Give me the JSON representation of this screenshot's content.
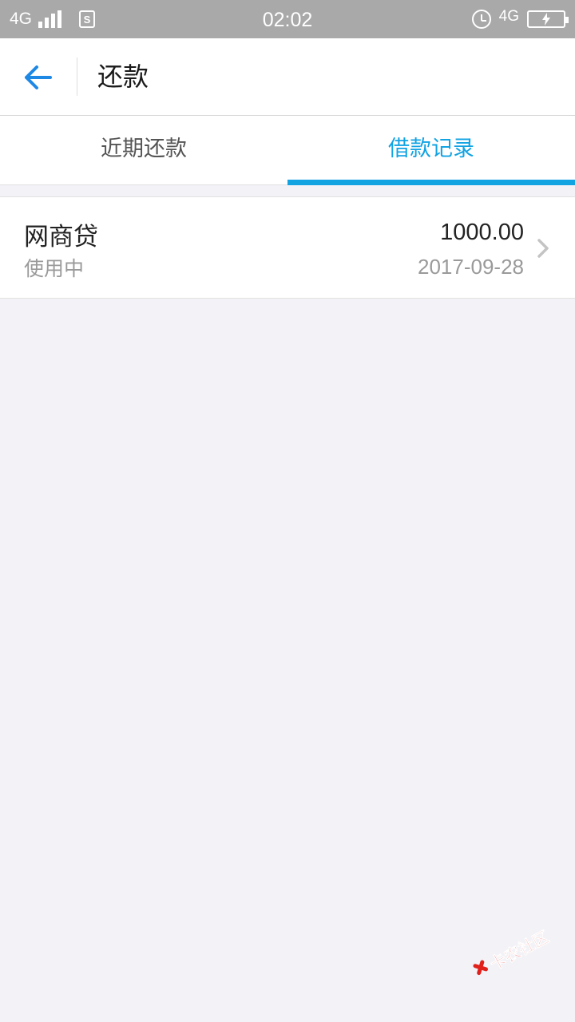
{
  "status_bar": {
    "network_left": "4G",
    "time": "02:02",
    "network_right": "4G"
  },
  "header": {
    "title": "还款"
  },
  "tabs": [
    {
      "label": "近期还款",
      "active": false
    },
    {
      "label": "借款记录",
      "active": true
    }
  ],
  "records": [
    {
      "name": "网商贷",
      "status": "使用中",
      "amount": "1000.00",
      "date": "2017-09-28"
    }
  ],
  "watermark": {
    "text": "卡农社区"
  },
  "colors": {
    "accent": "#12a3e3",
    "back_arrow": "#1e88e5",
    "background": "#f2f2f7",
    "status_bar": "#a9a9a9"
  },
  "icons": {
    "back": "arrow-left-icon",
    "row_chevron": "chevron-right-icon",
    "alarm": "alarm-icon",
    "battery": "battery-charging-icon"
  }
}
